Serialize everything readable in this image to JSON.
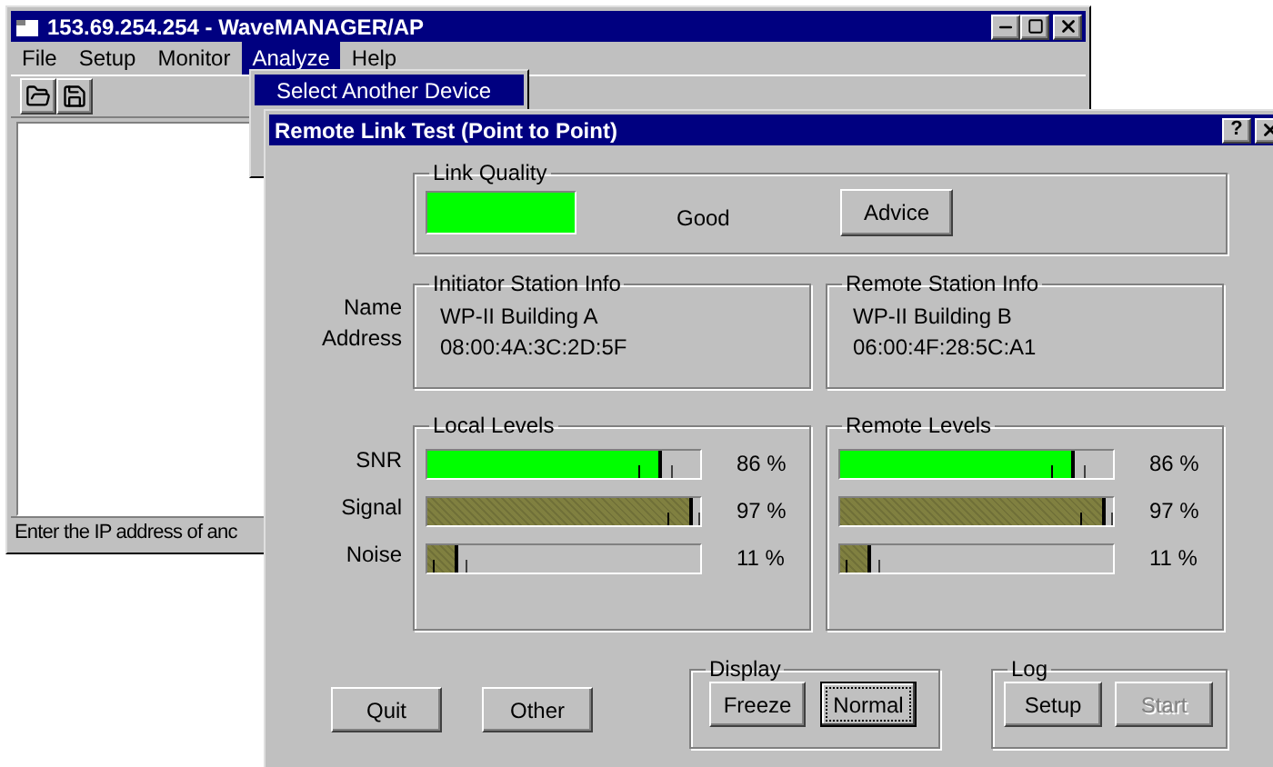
{
  "main_window": {
    "title": "153.69.254.254 - WaveMANAGER/AP",
    "menu": [
      {
        "label": "File",
        "selected": false
      },
      {
        "label": "Setup",
        "selected": false
      },
      {
        "label": "Monitor",
        "selected": false
      },
      {
        "label": "Analyze",
        "selected": true
      },
      {
        "label": "Help",
        "selected": false
      }
    ],
    "dropdown": [
      {
        "label": "Select Another Device",
        "selected": true
      }
    ],
    "status_bar": "Enter the IP address of anc"
  },
  "dialog": {
    "title": "Remote Link Test (Point to Point)",
    "help_button": "?",
    "link_quality": {
      "label": "Link Quality",
      "color": "#00ff00",
      "text": "Good",
      "button": "Advice"
    },
    "row_labels": [
      "Name",
      "Address"
    ],
    "stations": [
      {
        "label": "Initiator Station Info",
        "name": "WP-II Building A",
        "address": "08:00:4A:3C:2D:5F"
      },
      {
        "label": "Remote Station Info",
        "name": "WP-II Building B",
        "address": "06:00:4F:28:5C:A1"
      }
    ],
    "level_labels": [
      "SNR",
      "Signal",
      "Noise"
    ],
    "level_groups": [
      {
        "label": "Local Levels",
        "meters": [
          {
            "color": "#00ff00",
            "level": 0.86,
            "reading": "86 %"
          },
          {
            "color": "#808040",
            "level": 0.97,
            "reading": "97 %"
          },
          {
            "color": "#808040",
            "level": 0.11,
            "reading": "11 %"
          }
        ]
      },
      {
        "label": "Remote Levels",
        "meters": [
          {
            "color": "#00ff00",
            "level": 0.86,
            "reading": "86 %"
          },
          {
            "color": "#808040",
            "level": 0.97,
            "reading": "97 %"
          },
          {
            "color": "#808040",
            "level": 0.11,
            "reading": "11 %"
          }
        ]
      }
    ],
    "buttons": [
      {
        "label": "Quit"
      },
      {
        "label": "Other"
      }
    ],
    "display": {
      "label": "Display",
      "buttons": [
        {
          "label": "Freeze",
          "selected": false
        },
        {
          "label": "Normal",
          "selected": true
        }
      ]
    },
    "log": {
      "label": "Log",
      "buttons": [
        {
          "label": "Setup",
          "disabled": false
        },
        {
          "label": "Start",
          "disabled": true
        }
      ]
    }
  }
}
